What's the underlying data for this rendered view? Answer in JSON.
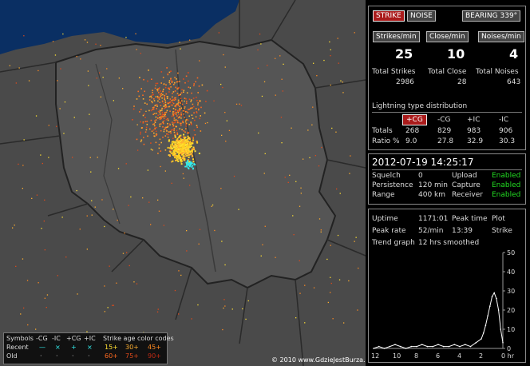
{
  "header": {
    "strike_tab": "STRIKE",
    "noise_tab": "NOISE",
    "bearing": "BEARING 339°"
  },
  "rates": {
    "strikes_label": "Strikes/min",
    "close_label": "Close/min",
    "noises_label": "Noises/min",
    "strikes_value": "25",
    "close_value": "10",
    "noises_value": "4",
    "total_strikes_label": "Total Strikes",
    "total_close_label": "Total Close",
    "total_noises_label": "Total Noises",
    "total_strikes": "2986",
    "total_close": "28",
    "total_noises": "643"
  },
  "distribution": {
    "title": "Lightning type distribution",
    "cols": [
      "+CG",
      "-CG",
      "+IC",
      "-IC"
    ],
    "totals_label": "Totals",
    "totals": [
      "268",
      "829",
      "983",
      "906"
    ],
    "ratio_label": "Ratio %",
    "ratio": [
      "9.0",
      "27.8",
      "32.9",
      "30.3"
    ]
  },
  "status": {
    "datetime": "2012-07-19 14:25:17",
    "squelch_label": "Squelch",
    "squelch": "0",
    "persistence_label": "Persistence",
    "persistence": "120 min",
    "range_label": "Range",
    "range": "400 km",
    "upload_label": "Upload",
    "upload": "Enabled",
    "capture_label": "Capture",
    "capture": "Enabled",
    "receiver_label": "Receiver",
    "receiver": "Enabled"
  },
  "stats": {
    "uptime_label": "Uptime",
    "uptime": "1171:01",
    "peak_time_label": "Peak time",
    "plot_label": "Plot",
    "peak_rate_label": "Peak rate",
    "peak_rate": "52/min",
    "peak_time": "13:39",
    "plot": "Strike",
    "trend_label": "Trend graph",
    "trend": "12 hrs smoothed"
  },
  "chart_data": {
    "type": "line",
    "x_ticks": [
      "12",
      "10",
      "8",
      "6",
      "4",
      "2",
      "0 hr"
    ],
    "y_ticks": [
      "50",
      "40",
      "30",
      "20",
      "10",
      "0"
    ],
    "ylim": [
      0,
      50
    ],
    "x": [
      12,
      11.5,
      11,
      10.5,
      10,
      9.5,
      9,
      8.5,
      8,
      7.5,
      7,
      6.5,
      6,
      5.5,
      5,
      4.5,
      4,
      3.5,
      3,
      2.5,
      2,
      1.8,
      1.6,
      1.4,
      1.2,
      1,
      0.8,
      0.6,
      0.4,
      0.2,
      0
    ],
    "values": [
      0,
      1,
      0,
      1,
      2,
      1,
      0,
      1,
      1,
      2,
      1,
      1,
      2,
      1,
      1,
      2,
      1,
      2,
      1,
      3,
      5,
      8,
      12,
      17,
      22,
      27,
      29,
      26,
      20,
      10,
      3
    ]
  },
  "legend": {
    "symbols_label": "Symbols",
    "codes": [
      "-CG",
      "-IC",
      "+CG",
      "+IC"
    ],
    "age_title": "Strike age color codes",
    "recent_label": "Recent",
    "old_label": "Old",
    "recent_ages": [
      "15+",
      "30+",
      "45+"
    ],
    "old_ages": [
      "60+",
      "75+",
      "90+"
    ],
    "recent_glyphs": [
      "—",
      "×",
      "+",
      "×"
    ],
    "old_glyphs": [
      "·",
      "·",
      "·",
      "·"
    ]
  },
  "copyright": "© 2010 www.GdzieJestBurza.pl",
  "colors": {
    "enabled": "#22dd22",
    "sea": "#0a2f63",
    "land": "#4a4a4a",
    "active_tab": "#aa1b1b"
  }
}
